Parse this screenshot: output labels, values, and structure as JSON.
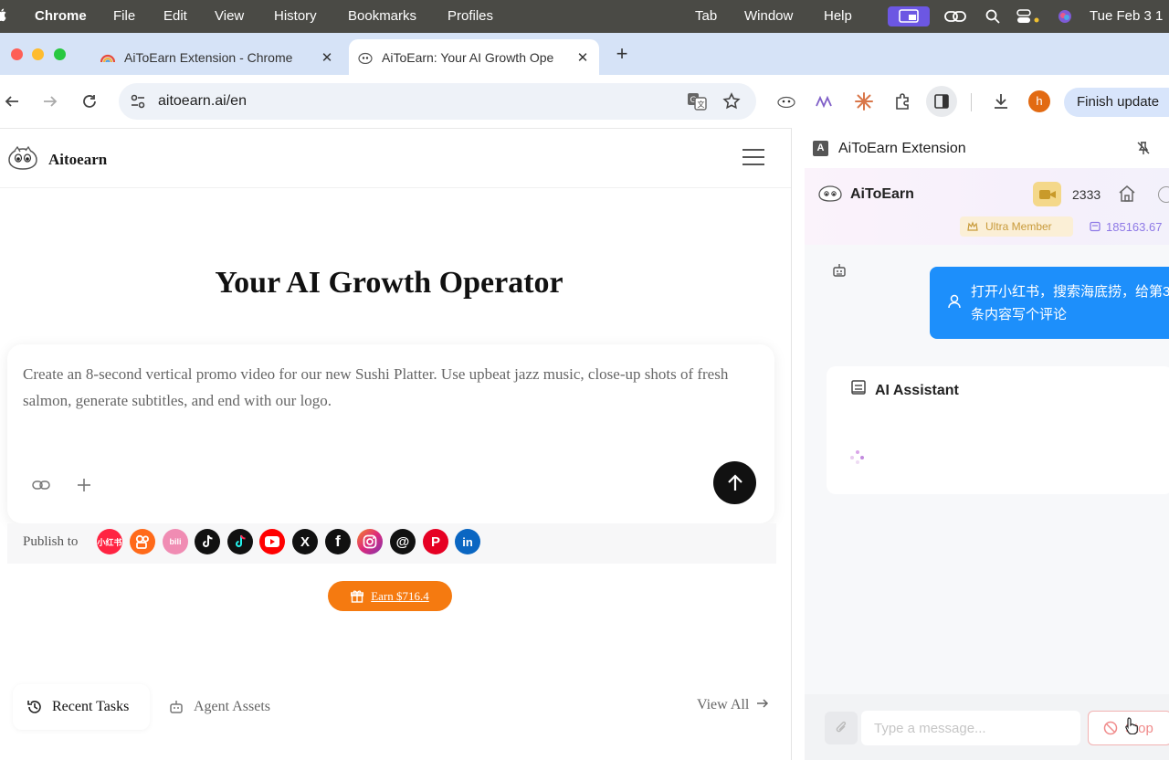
{
  "menubar": {
    "app": "Chrome",
    "items": [
      "File",
      "Edit",
      "View",
      "History",
      "Bookmarks",
      "Profiles",
      "Tab",
      "Window",
      "Help"
    ],
    "clock": "Tue Feb 3  1"
  },
  "tabs": [
    {
      "title": "AiToEarn Extension - Chrome",
      "active": false
    },
    {
      "title": "AiToEarn: Your AI Growth Ope",
      "active": true
    }
  ],
  "toolbar": {
    "url": "aitoearn.ai/en",
    "profile_initial": "h",
    "finish_update": "Finish update"
  },
  "page": {
    "brand": "Aitoearn",
    "hero_title": "Your AI Growth Operator",
    "prompt_text": "Create an 8-second vertical promo video for our new Sushi Platter. Use upbeat jazz music, close-up shots of fresh salmon, generate subtitles, and end with our logo.",
    "publish_label": "Publish to",
    "platforms": [
      {
        "name": "xiaohongshu",
        "label": "小红书",
        "color": "#ff2442"
      },
      {
        "name": "kuaishou",
        "label": "",
        "color": "#ff6a1a"
      },
      {
        "name": "bilibili",
        "label": "bili",
        "color": "#f08cb3"
      },
      {
        "name": "douyin",
        "label": "",
        "color": "#111111"
      },
      {
        "name": "tiktok",
        "label": "",
        "color": "#111111"
      },
      {
        "name": "youtube",
        "label": "",
        "color": "#ff0000"
      },
      {
        "name": "x",
        "label": "X",
        "color": "#111111"
      },
      {
        "name": "facebook",
        "label": "f",
        "color": "#111111"
      },
      {
        "name": "instagram",
        "label": "",
        "color": "#f0533f"
      },
      {
        "name": "threads",
        "label": "@",
        "color": "#111111"
      },
      {
        "name": "pinterest",
        "label": "P",
        "color": "#e60023"
      },
      {
        "name": "linkedin",
        "label": "in",
        "color": "#0a66c2"
      }
    ],
    "earn_button": "Earn $716.4",
    "recent_tasks": "Recent Tasks",
    "agent_assets": "Agent Assets",
    "view_all": "View All"
  },
  "panel": {
    "title": "AiToEarn Extension",
    "ext_name": "AiToEarn",
    "credits": "2333",
    "member": "Ultra Member",
    "user_id": "185163.67",
    "user_message": "打开小红书，搜索海底捞，给第3条内容写个评论",
    "assistant_label": "AI Assistant",
    "input_placeholder": "Type a message...",
    "stop_label": "Stop"
  },
  "colors": {
    "accent_blue": "#1d8ffb",
    "earn_orange": "#f57a10",
    "menubar": "#4a4a45",
    "tabstrip": "#d6e3f7"
  }
}
